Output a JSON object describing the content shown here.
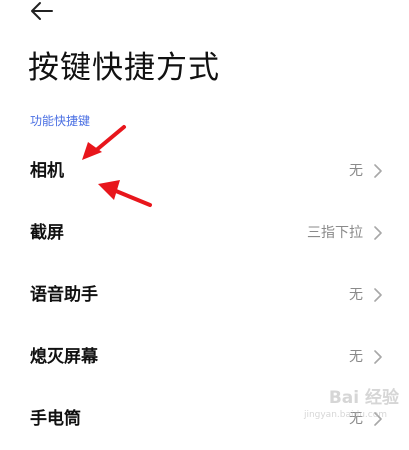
{
  "header": {
    "back_icon": "arrow-left-icon",
    "title": "按键快捷方式"
  },
  "section": {
    "title": "功能快捷键"
  },
  "items": [
    {
      "label": "相机",
      "value": "无"
    },
    {
      "label": "截屏",
      "value": "三指下拉"
    },
    {
      "label": "语音助手",
      "value": "无"
    },
    {
      "label": "熄灭屏幕",
      "value": "无"
    },
    {
      "label": "手电筒",
      "value": "无"
    }
  ],
  "colors": {
    "accent": "#4a6fe3",
    "annotation": "#e8161c"
  },
  "watermark": {
    "text": "Bai 经验",
    "sub": "jingyan.baidu.com"
  }
}
